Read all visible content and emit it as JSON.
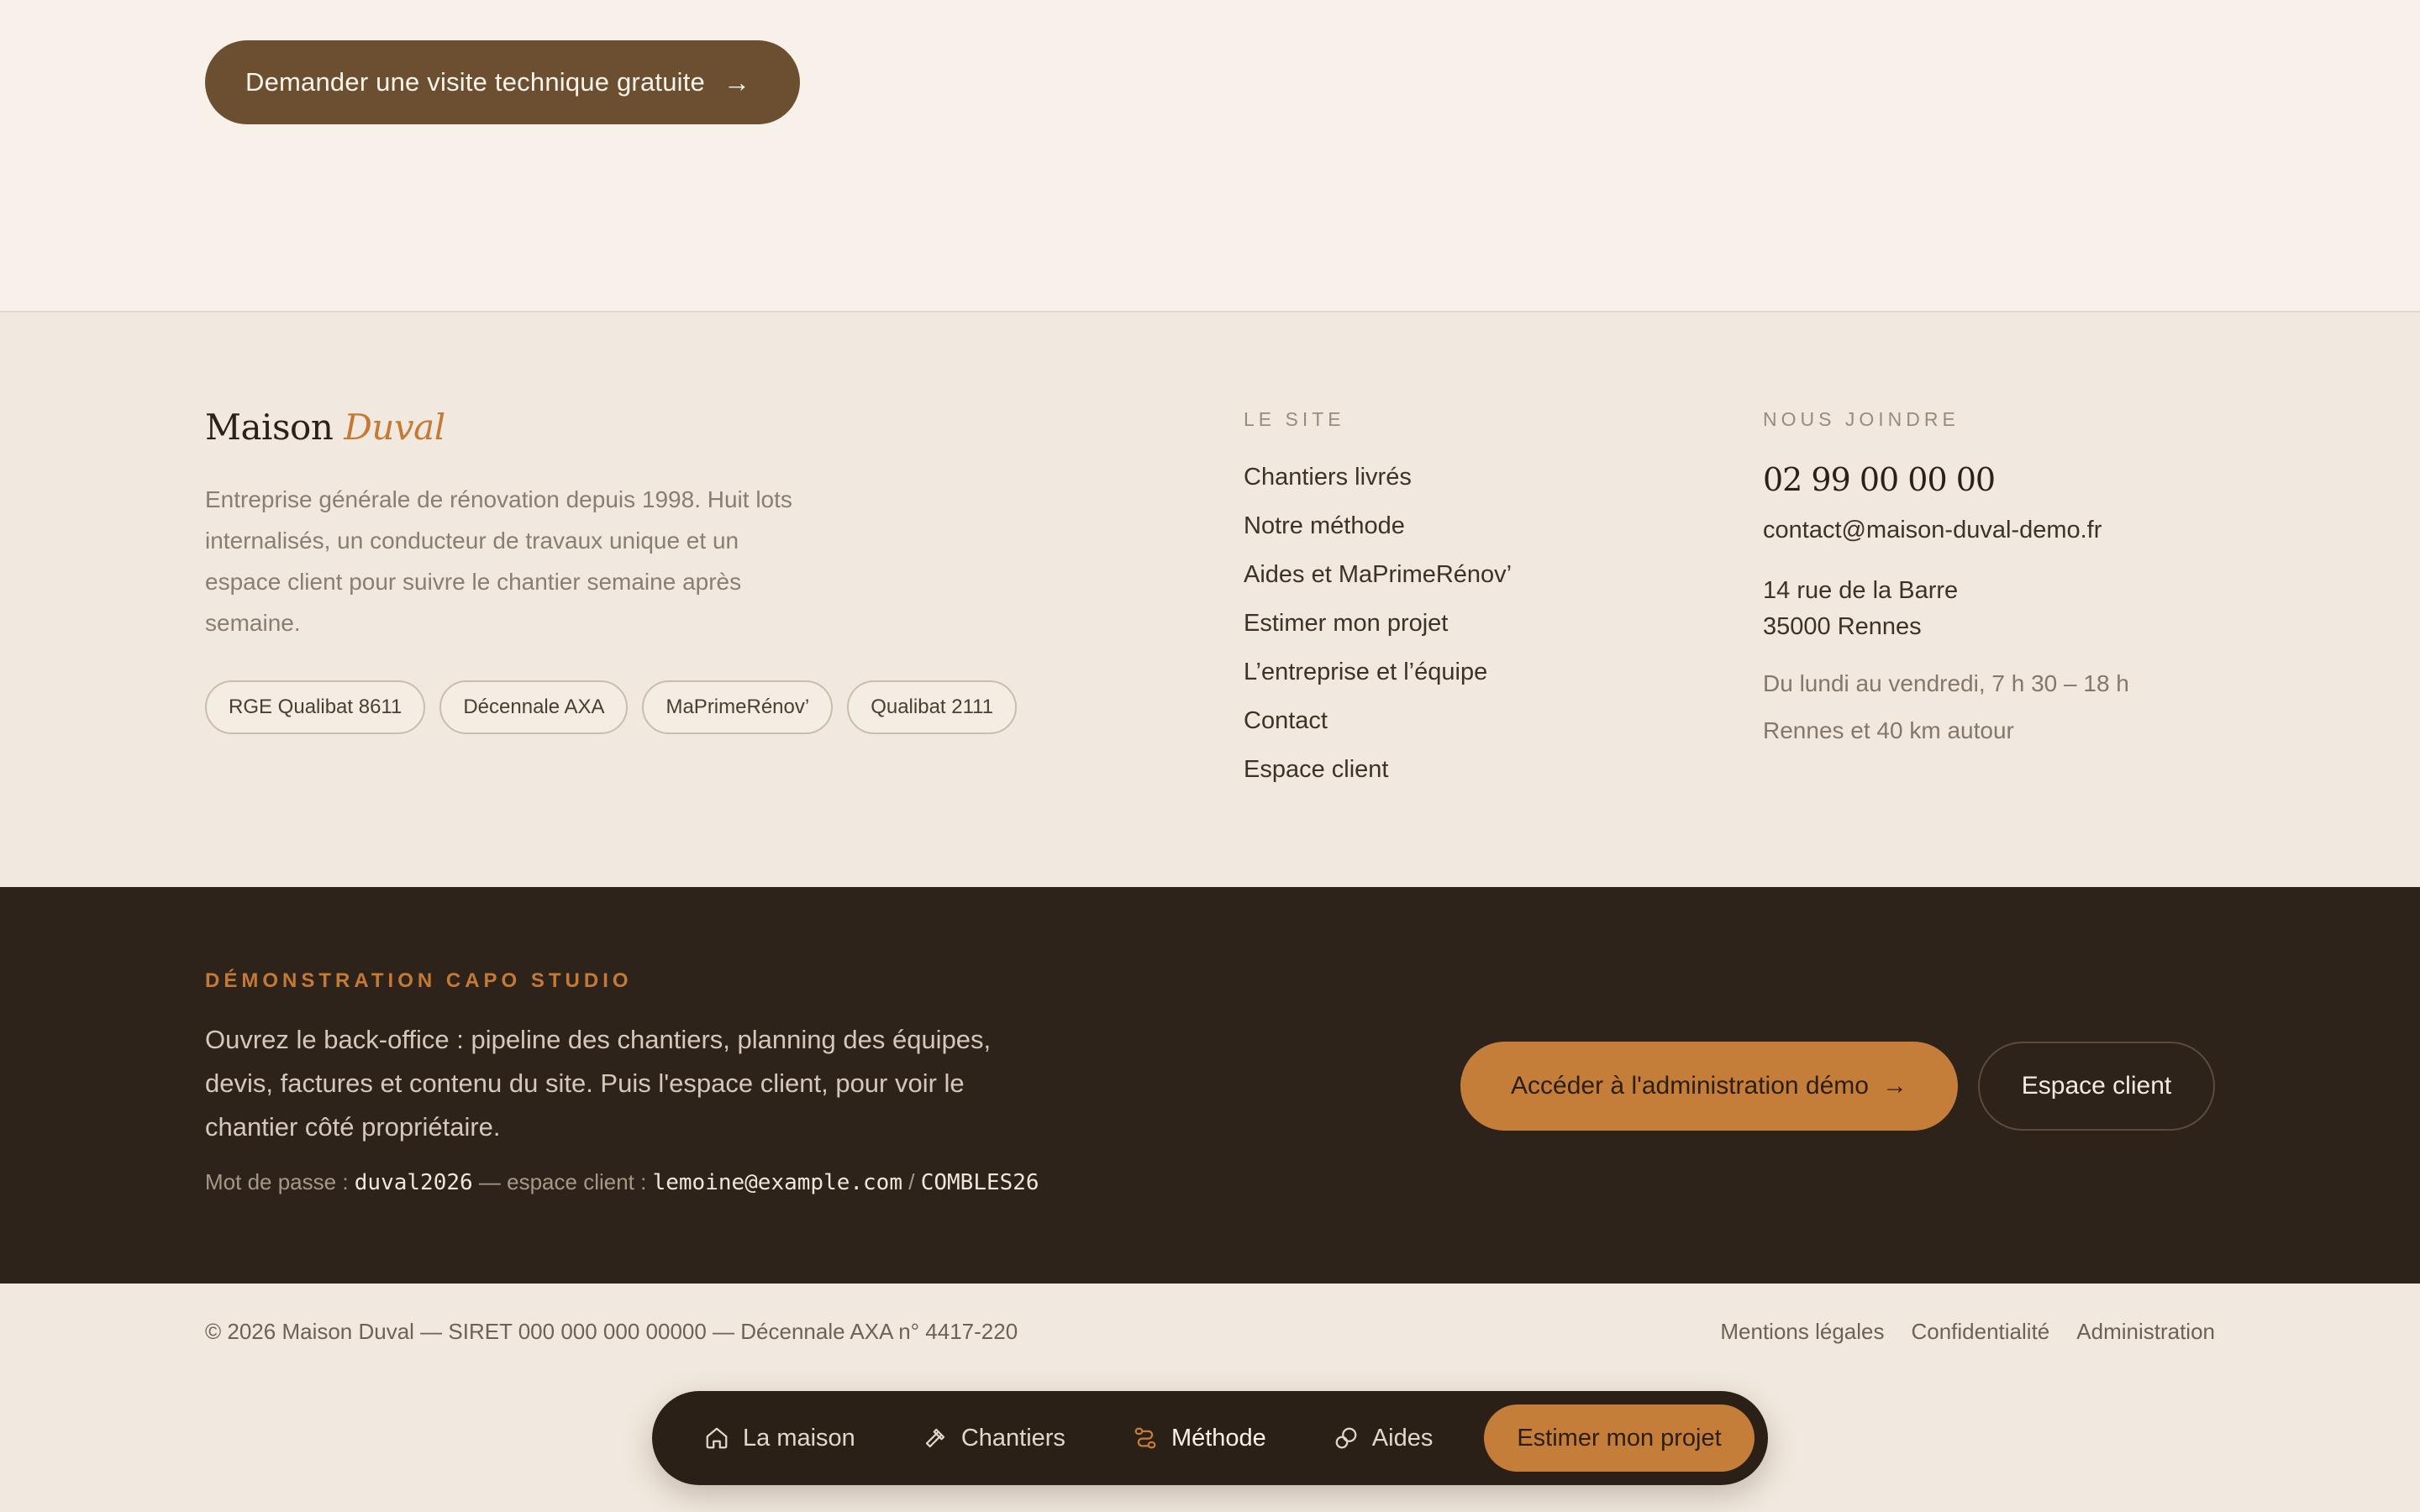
{
  "hero": {
    "cta_label": "Demander une visite technique gratuite",
    "cta_arrow": "→"
  },
  "brand": {
    "name_main": "Maison",
    "name_accent": "Duval",
    "description": "Entreprise générale de rénovation depuis 1998. Huit lots internalisés, un conducteur de travaux unique et un espace client pour suivre le chantier semaine après semaine.",
    "badges": [
      "RGE Qualibat 8611",
      "Décennale AXA",
      "MaPrimeRénov’",
      "Qualibat 2111"
    ]
  },
  "site_links": {
    "title": "LE SITE",
    "items": [
      "Chantiers livrés",
      "Notre méthode",
      "Aides et MaPrimeRénov’",
      "Estimer mon projet",
      "L’entreprise et l’équipe",
      "Contact",
      "Espace client"
    ]
  },
  "contact": {
    "title": "NOUS JOINDRE",
    "phone": "02 99 00 00 00",
    "email": "contact@maison-duval-demo.fr",
    "address_line1": "14 rue de la Barre",
    "address_line2": "35000 Rennes",
    "hours": "Du lundi au vendredi, 7 h 30 – 18 h",
    "area": "Rennes et 40 km autour"
  },
  "demo": {
    "title": "DÉMONSTRATION CAPO STUDIO",
    "description": "Ouvrez le back-office : pipeline des chantiers, planning des équipes, devis, factures et contenu du site. Puis l'espace client, pour voir le chantier côté propriétaire.",
    "pw_label": "Mot de passe :",
    "pw_value": "duval2026",
    "client_label": "— espace client :",
    "client_email": "lemoine@example.com",
    "separator": "/",
    "client_code": "COMBLES26",
    "admin_button": "Accéder à l'administration démo",
    "admin_arrow": "→",
    "client_button": "Espace client"
  },
  "bottom": {
    "copyright": "© 2026 Maison Duval — SIRET 000 000 000 00000 — Décennale AXA n° 4417-220",
    "links": [
      "Mentions légales",
      "Confidentialité",
      "Administration"
    ]
  },
  "dock": {
    "items": [
      {
        "label": "La maison",
        "icon": "home-icon"
      },
      {
        "label": "Chantiers",
        "icon": "hammer-icon"
      },
      {
        "label": "Méthode",
        "icon": "route-icon"
      },
      {
        "label": "Aides",
        "icon": "coins-icon"
      }
    ],
    "active_index": 2,
    "cta": "Estimer mon projet"
  },
  "colors": {
    "accent": "#c57d3a",
    "dark": "#2d231b",
    "cta_brown": "#6b4f30"
  }
}
